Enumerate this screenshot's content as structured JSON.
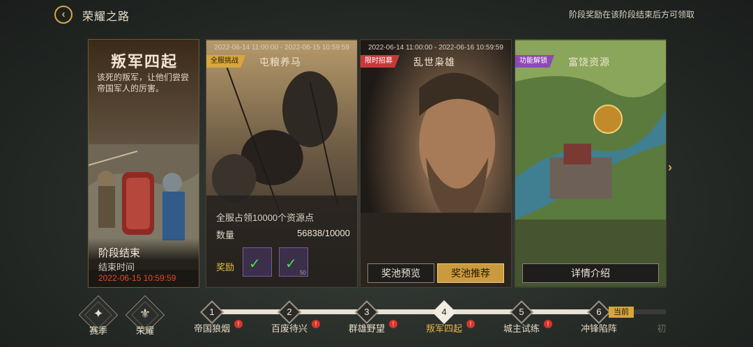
{
  "header": {
    "title": "荣耀之路",
    "note": "阶段奖励在该阶段结束后方可领取"
  },
  "intro": {
    "title": "叛军四起",
    "description": "该死的叛军，让他们尝尝帝国军人的厉害。",
    "status": "阶段结束",
    "end_label": "结束时间",
    "end_time": "2022-06-15 10:59:59"
  },
  "cards": [
    {
      "date_range": "2022-06-14 11:00:00 - 2022-06-15 10:59:59",
      "tag": "全服挑战",
      "title": "屯粮养马",
      "description": "全服占领10000个资源点",
      "quantity_label": "数量",
      "quantity_value": "56838/10000",
      "reward_label": "奖励",
      "reward_count": "50"
    },
    {
      "date_range": "2022-06-14 11:00:00 - 2022-06-16 10:59:59",
      "tag": "限时招募",
      "title": "乱世枭雄",
      "button_preview": "奖池预览",
      "button_recommend": "奖池推荐"
    },
    {
      "tag": "功能解锁",
      "title": "富饶资源",
      "button_details": "详情介绍"
    }
  ],
  "nav": {
    "season_label": "赛季",
    "honor_label": "荣耀",
    "current_label": "当前",
    "stages": [
      {
        "num": "1",
        "label": "帝国狼烟",
        "badge": "!"
      },
      {
        "num": "2",
        "label": "百废待兴",
        "badge": "!"
      },
      {
        "num": "3",
        "label": "群雄野望",
        "badge": "!"
      },
      {
        "num": "4",
        "label": "叛军四起",
        "badge": "!"
      },
      {
        "num": "5",
        "label": "城主试练",
        "badge": "!"
      },
      {
        "num": "6",
        "label": "冲锋陷阵"
      },
      {
        "label": "初"
      }
    ]
  },
  "colors": {
    "accent_gold": "#d9a843",
    "alert_red": "#e0482f",
    "tag_red": "#c8383b",
    "tag_purple": "#8f49b5"
  }
}
